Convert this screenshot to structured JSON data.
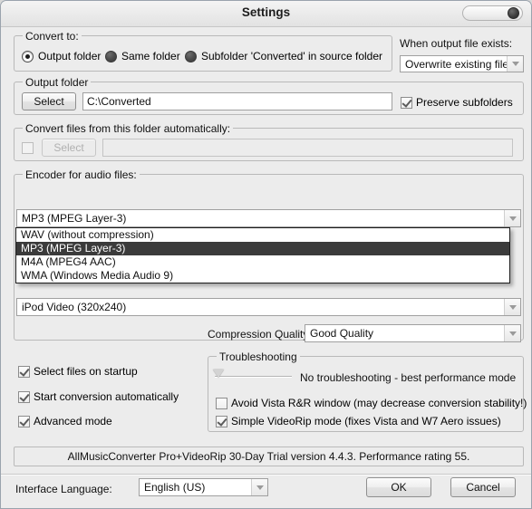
{
  "window": {
    "title": "Settings",
    "close_label": ""
  },
  "convert_to": {
    "group_title": "Convert to:",
    "options": [
      {
        "label": "Output folder",
        "selected": true
      },
      {
        "label": "Same folder",
        "selected": false
      },
      {
        "label": "Subfolder 'Converted' in source folder",
        "selected": false
      }
    ]
  },
  "output_exists": {
    "label": "When output file exists:",
    "value": "Overwrite existing file"
  },
  "output_folder": {
    "group_title": "Output folder",
    "select_label": "Select",
    "path_value": "C:\\Converted",
    "path_placeholder": "",
    "preserve_label": "Preserve subfolders",
    "preserve_checked": true
  },
  "auto_folder": {
    "group_title": "Convert files from this folder automatically:",
    "enabled_checked": false,
    "select_label": "Select",
    "path_value": "",
    "path_placeholder": ""
  },
  "encoder": {
    "group_title": "Encoder for audio files:",
    "value": "MP3 (MPEG Layer-3)",
    "options": [
      "WAV (without compression)",
      "MP3 (MPEG Layer-3)",
      "M4A (MPEG4 AAC)",
      "WMA (Windows Media Audio 9)"
    ],
    "selected_index": 1,
    "dropdown_open": true
  },
  "video_profile": {
    "value": "iPod Video (320x240)"
  },
  "compression": {
    "label": "Compression Quality",
    "value": "Good Quality"
  },
  "startup_options": [
    {
      "label": "Select files on startup",
      "checked": true
    },
    {
      "label": "Start conversion automatically",
      "checked": true
    },
    {
      "label": "Advanced mode",
      "checked": true
    }
  ],
  "troubleshooting": {
    "group_title": "Troubleshooting",
    "slider_label": "No troubleshooting - best performance mode",
    "slider_position": 0,
    "options": [
      {
        "label": "Avoid Vista R&R window (may decrease conversion stability!)",
        "checked": false
      },
      {
        "label": "Simple VideoRip mode (fixes Vista and W7 Aero issues)",
        "checked": true
      }
    ]
  },
  "status": {
    "text": "AllMusicConverter Pro+VideoRip 30-Day Trial version 4.4.3. Performance rating 55."
  },
  "footer": {
    "language_label": "Interface Language:",
    "language_value": "English (US)",
    "ok_label": "OK",
    "cancel_label": "Cancel"
  }
}
